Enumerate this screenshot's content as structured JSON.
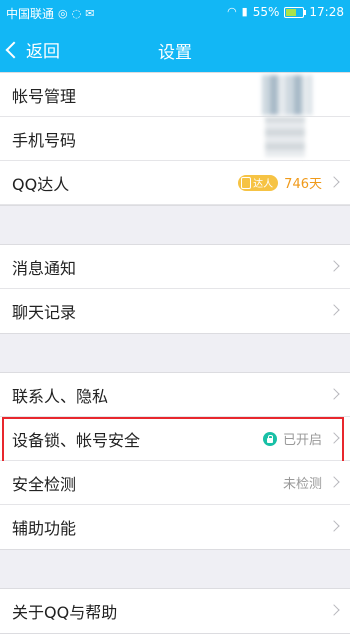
{
  "statusbar": {
    "carrier": "中国联通",
    "battery": "55%",
    "time": "17:28"
  },
  "titlebar": {
    "back_label": "返回",
    "title": "设置"
  },
  "groups": [
    [
      {
        "label": "帐号管理",
        "value": "",
        "arrow": false
      },
      {
        "label": "手机号码",
        "value": "",
        "arrow": false
      },
      {
        "label": "QQ达人",
        "badge": "达人",
        "value": "746天",
        "arrow": true
      }
    ],
    [
      {
        "label": "消息通知",
        "value": "",
        "arrow": true
      },
      {
        "label": "聊天记录",
        "value": "",
        "arrow": true
      }
    ],
    [
      {
        "label": "联系人、隐私",
        "value": "",
        "arrow": true
      },
      {
        "label": "设备锁、帐号安全",
        "value": "已开启",
        "arrow": true
      },
      {
        "label": "安全检测",
        "value": "未检测",
        "arrow": true
      },
      {
        "label": "辅助功能",
        "value": "",
        "arrow": true
      }
    ],
    [
      {
        "label": "关于QQ与帮助",
        "value": "",
        "arrow": true
      }
    ]
  ],
  "colors": {
    "accent": "#12b7f5",
    "highlight": "#e8272d",
    "orange": "#f09a1a"
  }
}
